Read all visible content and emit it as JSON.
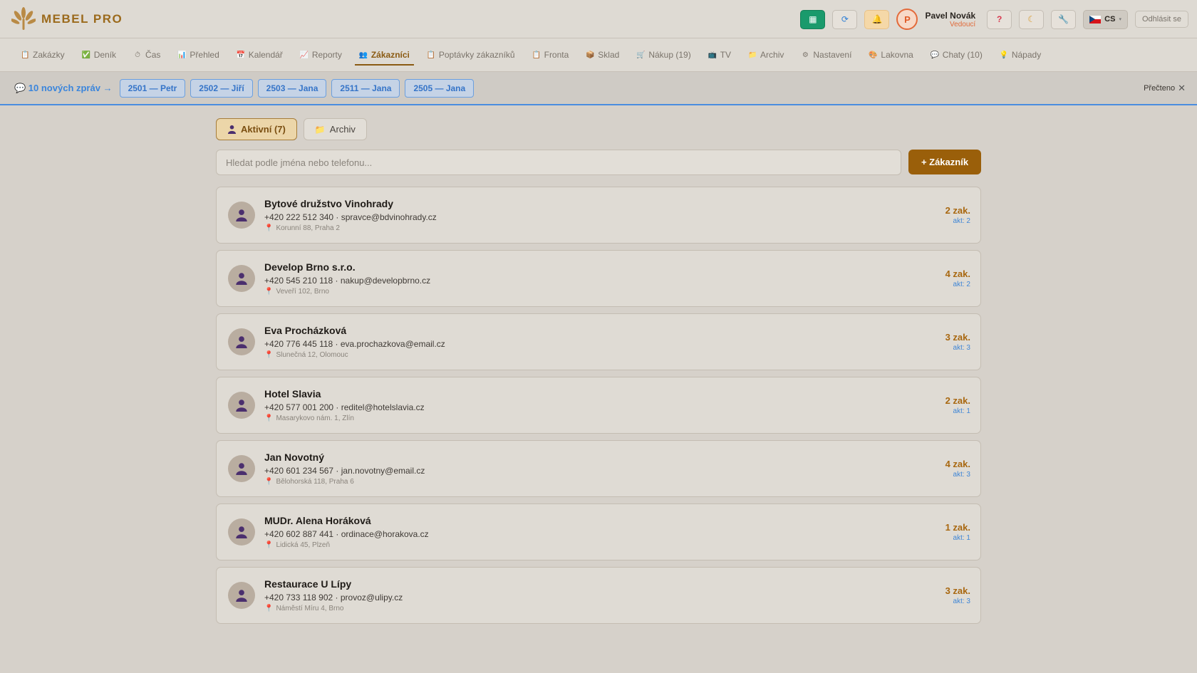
{
  "app": {
    "name": "MEBEL PRO"
  },
  "header": {
    "icon_buttons": [
      {
        "name": "dashboard-icon",
        "glyph": "▦"
      },
      {
        "name": "refresh-icon",
        "glyph": "⟳"
      },
      {
        "name": "notification-icon",
        "glyph": "🔔"
      }
    ],
    "user": {
      "initial": "P",
      "name": "Pavel Novák",
      "role": "Vedoucí"
    },
    "tools": [
      {
        "name": "help-icon",
        "glyph": "?"
      },
      {
        "name": "theme-icon",
        "glyph": "☾"
      },
      {
        "name": "wrench-icon",
        "glyph": "🔧"
      }
    ],
    "language": "CS",
    "logout_label": "Odhlásit se"
  },
  "nav": [
    {
      "label": "Zakázky",
      "icon": "📋"
    },
    {
      "label": "Deník",
      "icon": "✅"
    },
    {
      "label": "Čas",
      "icon": "⏱"
    },
    {
      "label": "Přehled",
      "icon": "📊"
    },
    {
      "label": "Kalendář",
      "icon": "📅"
    },
    {
      "label": "Reporty",
      "icon": "📈"
    },
    {
      "label": "Zákazníci",
      "icon": "👥",
      "active": true
    },
    {
      "label": "Poptávky zákazníků",
      "icon": "📋"
    },
    {
      "label": "Fronta",
      "icon": "📋"
    },
    {
      "label": "Sklad",
      "icon": "📦"
    },
    {
      "label": "Nákup (19)",
      "icon": "🛒"
    },
    {
      "label": "TV",
      "icon": "📺"
    },
    {
      "label": "Archiv",
      "icon": "📁"
    },
    {
      "label": "Nastavení",
      "icon": "⚙"
    },
    {
      "label": "Lakovna",
      "icon": "🎨"
    },
    {
      "label": "Chaty (10)",
      "icon": "💬"
    },
    {
      "label": "Nápady",
      "icon": "💡"
    }
  ],
  "messages": {
    "lead": "💬 10 nových zpráv →",
    "chips": [
      "2501 — Petr",
      "2502 — Jiří",
      "2503 — Jana",
      "2511 — Jana",
      "2505 — Jana"
    ],
    "read_label": "Přečteno"
  },
  "tabs": {
    "active": "Aktivní (7)",
    "archive": "Archiv"
  },
  "search": {
    "placeholder": "Hledat podle jména nebo telefonu..."
  },
  "add_button": "+ Zákazník",
  "customers": [
    {
      "name": "Bytové družstvo Vinohrady",
      "contact": "+420 222 512 340 · spravce@bdvinohrady.cz",
      "address": "Korunní 88, Praha 2",
      "orders": "2 zak.",
      "active": "akt: 2"
    },
    {
      "name": "Develop Brno s.r.o.",
      "contact": "+420 545 210 118 · nakup@developbrno.cz",
      "address": "Veveří 102, Brno",
      "orders": "4 zak.",
      "active": "akt: 2"
    },
    {
      "name": "Eva Procházková",
      "contact": "+420 776 445 118 · eva.prochazkova@email.cz",
      "address": "Slunečná 12, Olomouc",
      "orders": "3 zak.",
      "active": "akt: 3"
    },
    {
      "name": "Hotel Slavia",
      "contact": "+420 577 001 200 · reditel@hotelslavia.cz",
      "address": "Masarykovo nám. 1, Zlín",
      "orders": "2 zak.",
      "active": "akt: 1"
    },
    {
      "name": "Jan Novotný",
      "contact": "+420 601 234 567 · jan.novotny@email.cz",
      "address": "Bělohorská 118, Praha 6",
      "orders": "4 zak.",
      "active": "akt: 3"
    },
    {
      "name": "MUDr. Alena Horáková",
      "contact": "+420 602 887 441 · ordinace@horakova.cz",
      "address": "Lidická 45, Plzeň",
      "orders": "1 zak.",
      "active": "akt: 1"
    },
    {
      "name": "Restaurace U Lípy",
      "contact": "+420 733 118 902 · provoz@ulipy.cz",
      "address": "Náměstí Míru 4, Brno",
      "orders": "3 zak.",
      "active": "akt: 3"
    }
  ]
}
